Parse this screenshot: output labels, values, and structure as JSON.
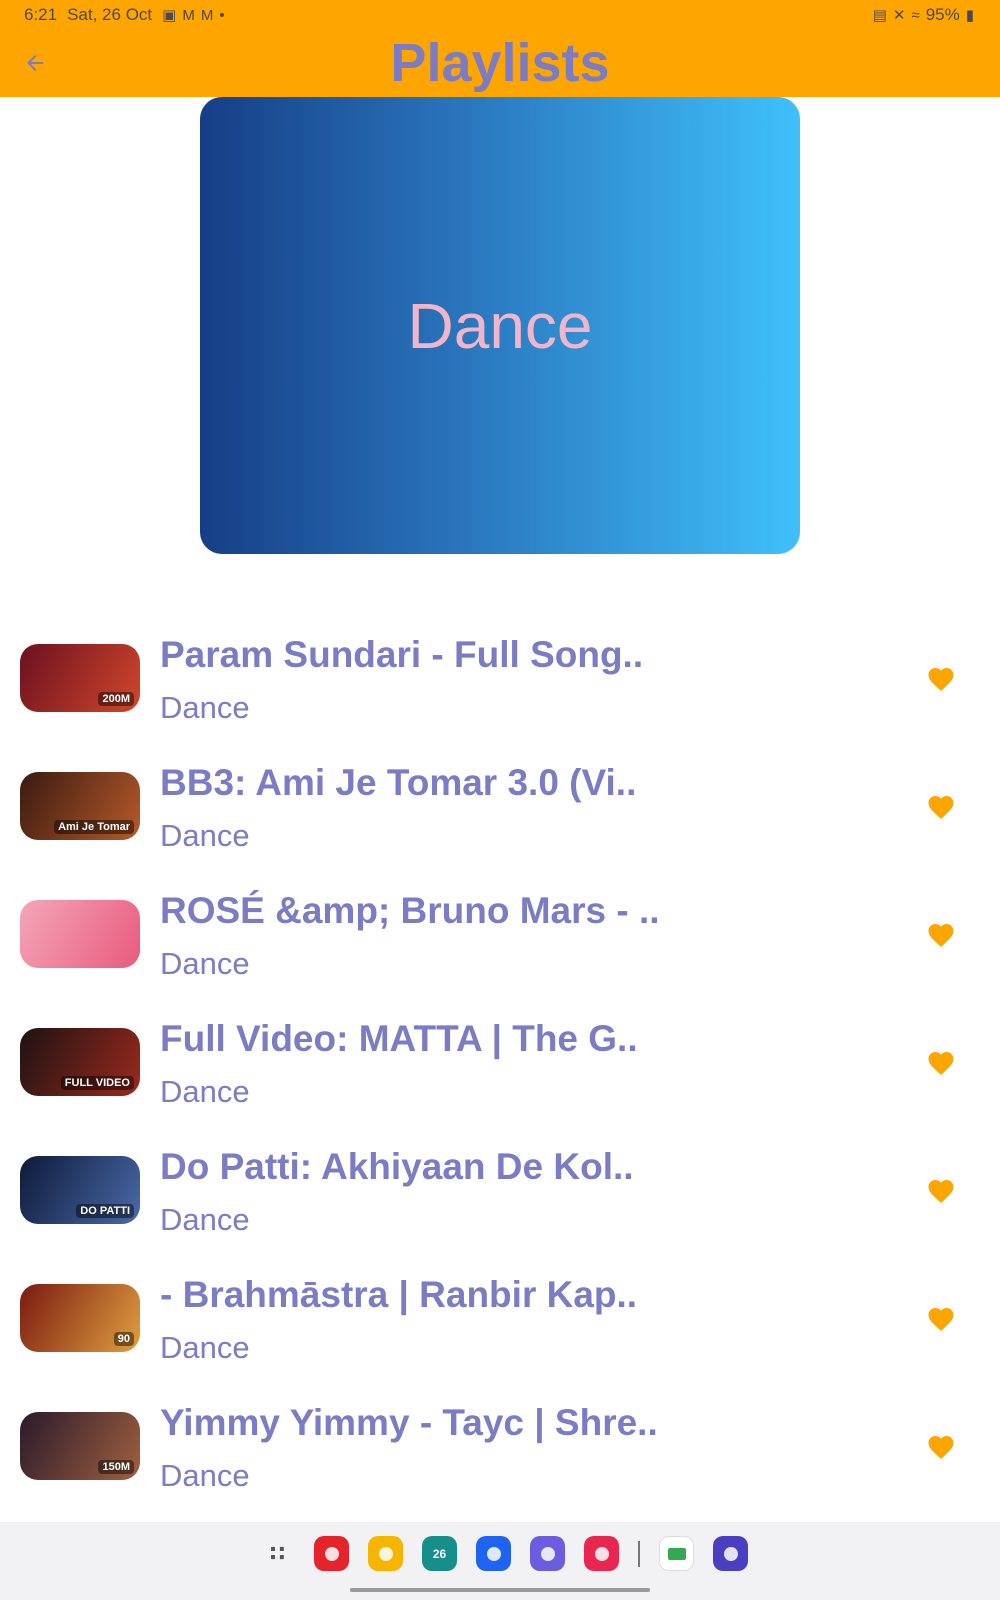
{
  "status_bar": {
    "time": "6:21",
    "date": "Sat, 26 Oct",
    "battery": "95%",
    "notification_icons": [
      "image-icon",
      "gmail-icon",
      "gmail-icon",
      "dot-icon"
    ],
    "system_icons": [
      "lock-icon",
      "mute-icon",
      "wifi-icon",
      "battery-icon"
    ]
  },
  "app_bar": {
    "title": "Playlists",
    "back_icon": "arrow-left-icon",
    "color": "#FFA500"
  },
  "cover": {
    "title": "Dance",
    "gradient": [
      "#163E86",
      "#2A77BE",
      "#3FC1FB"
    ]
  },
  "songs": [
    {
      "title": "Param Sundari - Full Song..",
      "subtitle": "Dance",
      "thumb_colors": [
        "#6b1020",
        "#d2472b"
      ],
      "thumb_label": "200M"
    },
    {
      "title": "BB3: Ami Je Tomar 3.0 (Vi..",
      "subtitle": "Dance",
      "thumb_colors": [
        "#3a1a10",
        "#b75a2b"
      ],
      "thumb_label": "Ami Je Tomar"
    },
    {
      "title": "ROSÉ &amp; Bruno Mars - ..",
      "subtitle": "Dance",
      "thumb_colors": [
        "#f4a6b8",
        "#e85a7e"
      ],
      "thumb_label": ""
    },
    {
      "title": "Full Video: MATTA | The G..",
      "subtitle": "Dance",
      "thumb_colors": [
        "#1d1212",
        "#9b2a1e"
      ],
      "thumb_label": "FULL VIDEO"
    },
    {
      "title": "Do Patti: Akhiyaan De Kol..",
      "subtitle": "Dance",
      "thumb_colors": [
        "#0e1a3a",
        "#4a6aa8"
      ],
      "thumb_label": "DO PATTI"
    },
    {
      "title": "- Brahmāstra | Ranbir Kap..",
      "subtitle": "Dance",
      "thumb_colors": [
        "#7a1a10",
        "#e0a040"
      ],
      "thumb_label": "90"
    },
    {
      "title": "Yimmy Yimmy - Tayc | Shre..",
      "subtitle": "Dance",
      "thumb_colors": [
        "#2a1a2a",
        "#a06040"
      ],
      "thumb_label": "150M"
    }
  ],
  "accent_colors": {
    "text": "#7B7CC4",
    "heart": "#FFA500"
  },
  "dock": {
    "apps": [
      {
        "name": "app-drawer-icon",
        "color": "#F2F2F5"
      },
      {
        "name": "flipboard-icon",
        "color": "#E5232A"
      },
      {
        "name": "files-icon",
        "color": "#F7B500"
      },
      {
        "name": "calendar-icon",
        "color": "#168E8A",
        "label": "26"
      },
      {
        "name": "messages-icon",
        "color": "#1E64F0"
      },
      {
        "name": "internet-icon",
        "color": "#6B5CE0"
      },
      {
        "name": "camera-icon",
        "color": "#E8264F"
      },
      {
        "name": "meet-icon",
        "color": "#ffffff"
      },
      {
        "name": "music-icon",
        "color": "#4A3FC0"
      }
    ]
  }
}
